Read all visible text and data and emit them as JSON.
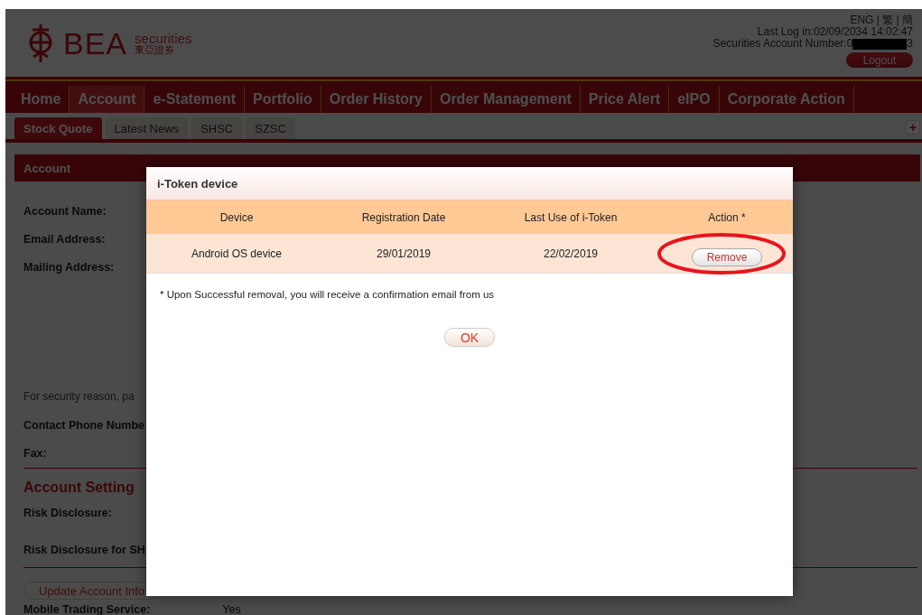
{
  "header": {
    "logo": {
      "brand": "BEA",
      "product": "securities",
      "chinese": "東亞證券"
    },
    "languages": "ENG | 繁 | 簡",
    "last_login": "Last Log in:02/09/2034 14:02:47",
    "account_number_prefix": "Securities Account Number:0",
    "account_number_suffix": "3",
    "logout": "Logout"
  },
  "nav": [
    {
      "label": "Home",
      "selected": false
    },
    {
      "label": "Account",
      "selected": true
    },
    {
      "label": "e-Statement",
      "selected": false
    },
    {
      "label": "Portfolio",
      "selected": false
    },
    {
      "label": "Order History",
      "selected": false
    },
    {
      "label": "Order Management",
      "selected": false
    },
    {
      "label": "Price Alert",
      "selected": false
    },
    {
      "label": "eIPO",
      "selected": false
    },
    {
      "label": "Corporate Action",
      "selected": false
    }
  ],
  "tabs": [
    {
      "label": "Stock Quote",
      "selected": true
    },
    {
      "label": "Latest News",
      "selected": false
    },
    {
      "label": "SHSC",
      "selected": false
    },
    {
      "label": "SZSC",
      "selected": false
    }
  ],
  "plus_button": "+",
  "panel": {
    "title": "Account",
    "account_fields": [
      "Account Name:",
      "Email Address:",
      "Mailing Address:"
    ],
    "note": "For security reason, pa",
    "contact_fields": [
      "Contact Phone Numbe",
      "Fax:"
    ],
    "section_title": "Account Setting",
    "setting_fields": [
      "Risk Disclosure:",
      "Risk Disclosure for SH"
    ],
    "update_button": "Update Account Info",
    "mobile": {
      "label": "Mobile Trading Service:",
      "value": "Yes"
    }
  },
  "dialog": {
    "title": "i-Token device",
    "columns": [
      "Device",
      "Registration Date",
      "Last Use of i-Token",
      "Action *"
    ],
    "rows": [
      {
        "cells": [
          "Android OS device",
          "29/01/2019",
          "22/02/2019"
        ],
        "action": "Remove",
        "highlighted": true
      }
    ],
    "footnote": "* Upon Successful removal, you will receive a confirmation email from us",
    "ok": "OK"
  }
}
